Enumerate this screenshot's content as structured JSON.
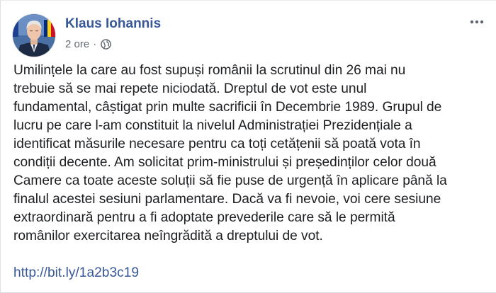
{
  "post": {
    "author": "Klaus Iohannis",
    "time": "2 ore",
    "separator": "·",
    "privacy_icon": "globe-icon",
    "menu_icon": "more-options-icon",
    "lines": [
      "Umilințele la care au fost supuși românii la scrutinul din 26 mai nu",
      "trebuie să se mai repete niciodată. Dreptul de vot este unul",
      "fundamental, câștigat prin multe sacrificii în Decembrie 1989. Grupul de",
      "lucru pe care l-am constituit la nivelul Administrației Prezidențiale a",
      "identificat măsurile necesare pentru ca toți cetățenii să poată vota în",
      "condiții decente. Am solicitat prim-ministrului și președinților celor două",
      "Camere ca toate aceste soluții să fie puse de urgență în aplicare până la",
      "finalul acestei sesiuni parlamentare. Dacă va fi nevoie, voi cere sesiune",
      "extraordinară pentru a fi adoptate prevederile care să le permită",
      "românilor exercitarea neîngrădită a dreptului de vot."
    ],
    "link": "http://bit.ly/1a2b3c19"
  },
  "colors": {
    "author": "#385898",
    "link": "#385898",
    "text": "#1c1e21",
    "meta": "#606770"
  }
}
